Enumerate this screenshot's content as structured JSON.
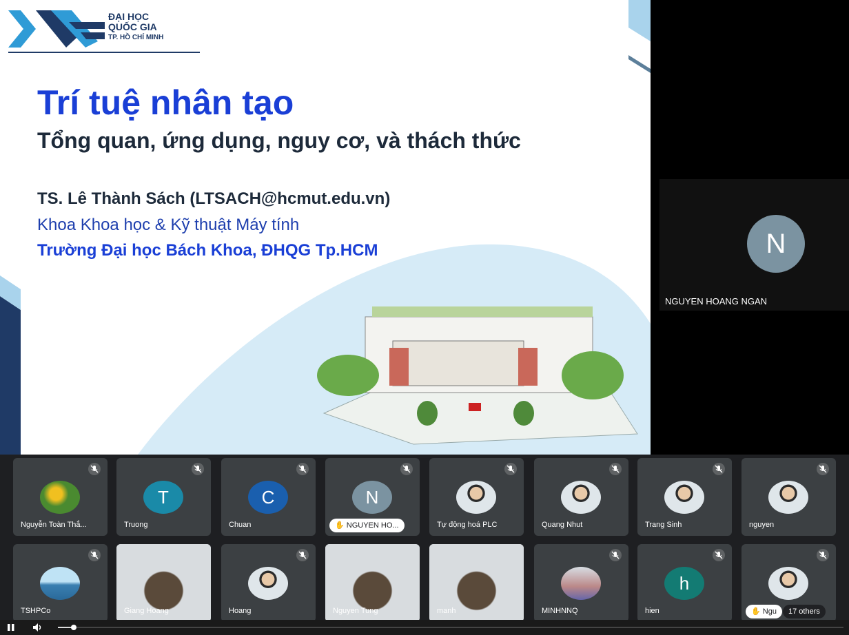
{
  "slide": {
    "logo": {
      "line1": "ĐẠI HỌC",
      "line2": "QUỐC GIA",
      "line3": "TP. HỒ CHÍ MINH"
    },
    "title": "Trí tuệ nhân tạo",
    "subtitle": "Tổng quan, ứng dụng, nguy cơ, và thách thức",
    "author": "TS. Lê Thành Sách (LTSACH@hcmut.edu.vn)",
    "faculty": "Khoa Khoa học & Kỹ thuật Máy tính",
    "university": "Trường Đại học Bách Khoa, ĐHQG Tp.HCM"
  },
  "speaker": {
    "initial": "N",
    "name": "NGUYEN HOANG NGAN"
  },
  "participants": [
    {
      "name": "Nguyễn Toàn Thắ...",
      "kind": "photo",
      "photo": "flowers"
    },
    {
      "name": "Truong",
      "kind": "initial",
      "initial": "T",
      "color": "#1a8aa8"
    },
    {
      "name": "Chuan",
      "kind": "initial",
      "initial": "C",
      "color": "#1a5fae"
    },
    {
      "name": "NGUYEN HO...",
      "kind": "initial",
      "initial": "N",
      "color": "#7b93a1",
      "hand": true
    },
    {
      "name": "Tự động hoá PLC",
      "kind": "photo",
      "photo": "person"
    },
    {
      "name": "Quang Nhut",
      "kind": "photo",
      "photo": "person"
    },
    {
      "name": "Trang Sinh",
      "kind": "photo",
      "photo": "person"
    },
    {
      "name": "nguyen",
      "kind": "photo",
      "photo": "person"
    },
    {
      "name": "TSHPCo",
      "kind": "photo",
      "photo": "landscape"
    },
    {
      "name": "Giang Hoang",
      "kind": "video"
    },
    {
      "name": "Hoang",
      "kind": "photo",
      "photo": "person"
    },
    {
      "name": "Nguyen Tung",
      "kind": "video"
    },
    {
      "name": "manh",
      "kind": "video"
    },
    {
      "name": "MINHNNQ",
      "kind": "photo",
      "photo": "group"
    },
    {
      "name": "hien",
      "kind": "initial",
      "initial": "h",
      "color": "#137b73"
    },
    {
      "name": "Ngu",
      "kind": "photo",
      "photo": "person",
      "hand": true
    }
  ],
  "others_label": "17 others",
  "player": {
    "progress": 0.02
  }
}
